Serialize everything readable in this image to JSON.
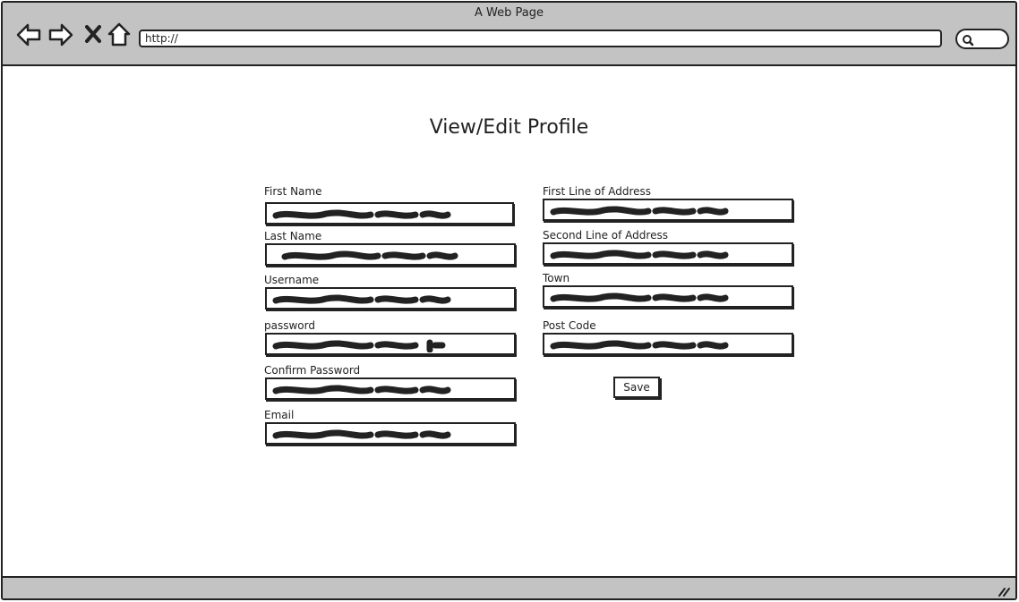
{
  "window": {
    "title": "A Web Page"
  },
  "toolbar": {
    "back_icon": "back-arrow-icon",
    "forward_icon": "forward-arrow-icon",
    "stop_icon": "close-x-icon",
    "home_icon": "home-icon",
    "url": "http://",
    "search_icon": "search-icon"
  },
  "page": {
    "title": "View/Edit Profile"
  },
  "form": {
    "left_fields": [
      {
        "label": "First Name"
      },
      {
        "label": "Last Name"
      },
      {
        "label": "Username"
      },
      {
        "label": "password"
      },
      {
        "label": "Confirm Password"
      },
      {
        "label": "Email"
      }
    ],
    "right_fields": [
      {
        "label": "First Line of Address"
      },
      {
        "label": "Second Line of Address"
      },
      {
        "label": "Town"
      },
      {
        "label": "Post Code"
      }
    ],
    "save_label": "Save"
  }
}
